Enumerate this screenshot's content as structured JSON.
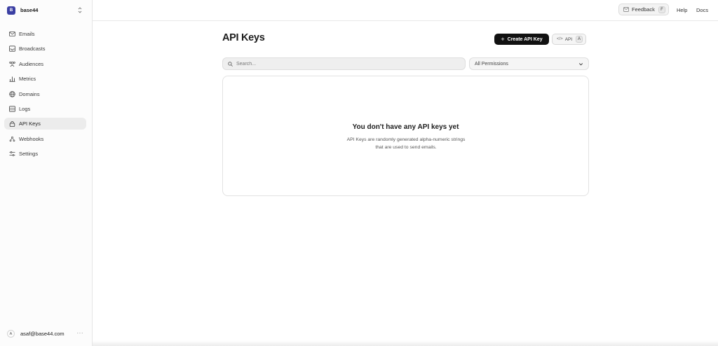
{
  "team": {
    "initial": "B",
    "name": "base44"
  },
  "sidebar": {
    "items": [
      {
        "label": "Emails",
        "icon": "mail-icon",
        "active": false
      },
      {
        "label": "Broadcasts",
        "icon": "broadcast-icon",
        "active": false
      },
      {
        "label": "Audiences",
        "icon": "audiences-icon",
        "active": false
      },
      {
        "label": "Metrics",
        "icon": "bar-chart-icon",
        "active": false
      },
      {
        "label": "Domains",
        "icon": "globe-icon",
        "active": false
      },
      {
        "label": "Logs",
        "icon": "list-icon",
        "active": false
      },
      {
        "label": "API Keys",
        "icon": "lock-icon",
        "active": true
      },
      {
        "label": "Webhooks",
        "icon": "webhook-icon",
        "active": false
      },
      {
        "label": "Settings",
        "icon": "sliders-icon",
        "active": false
      }
    ]
  },
  "user": {
    "initial": "A",
    "email": "asaf@base44.com",
    "more": "···"
  },
  "topbar": {
    "feedback_label": "Feedback",
    "feedback_shortcut": "F",
    "help_label": "Help",
    "docs_label": "Docs"
  },
  "page": {
    "title": "API Keys",
    "create_label": "Create API Key",
    "api_label": "API",
    "api_shortcut": "A"
  },
  "filters": {
    "search_placeholder": "Search...",
    "permission_value": "All Permissions"
  },
  "empty_state": {
    "title": "You don't have any API keys yet",
    "description": "API Keys are randomly generated alpha-numeric strings that are used to send emails."
  },
  "colors": {
    "team_avatar": "#3b3fa3",
    "primary_button": "#111111",
    "active_nav": "#ececec"
  }
}
